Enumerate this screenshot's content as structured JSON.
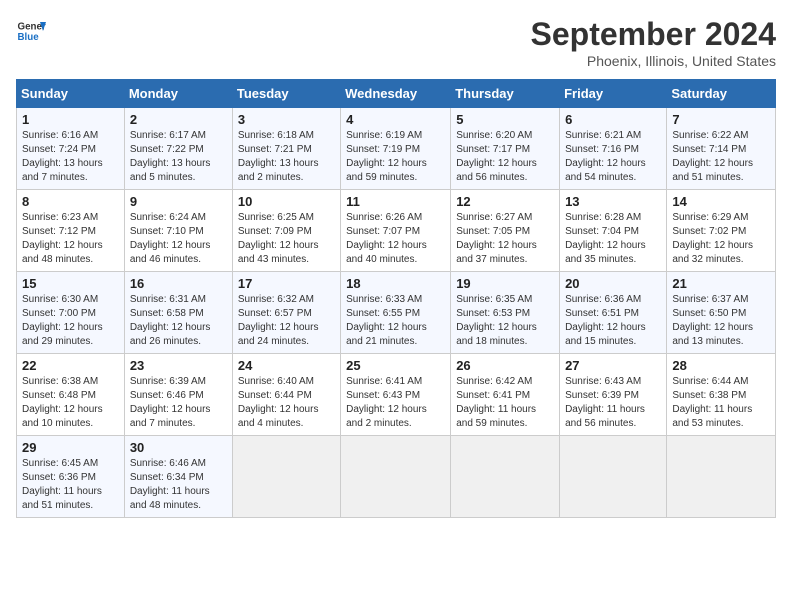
{
  "header": {
    "logo_line1": "General",
    "logo_line2": "Blue",
    "month_title": "September 2024",
    "location": "Phoenix, Illinois, United States"
  },
  "weekdays": [
    "Sunday",
    "Monday",
    "Tuesday",
    "Wednesday",
    "Thursday",
    "Friday",
    "Saturday"
  ],
  "weeks": [
    [
      {
        "day": "1",
        "sunrise": "6:16 AM",
        "sunset": "7:24 PM",
        "daylight": "13 hours and 7 minutes."
      },
      {
        "day": "2",
        "sunrise": "6:17 AM",
        "sunset": "7:22 PM",
        "daylight": "13 hours and 5 minutes."
      },
      {
        "day": "3",
        "sunrise": "6:18 AM",
        "sunset": "7:21 PM",
        "daylight": "13 hours and 2 minutes."
      },
      {
        "day": "4",
        "sunrise": "6:19 AM",
        "sunset": "7:19 PM",
        "daylight": "12 hours and 59 minutes."
      },
      {
        "day": "5",
        "sunrise": "6:20 AM",
        "sunset": "7:17 PM",
        "daylight": "12 hours and 56 minutes."
      },
      {
        "day": "6",
        "sunrise": "6:21 AM",
        "sunset": "7:16 PM",
        "daylight": "12 hours and 54 minutes."
      },
      {
        "day": "7",
        "sunrise": "6:22 AM",
        "sunset": "7:14 PM",
        "daylight": "12 hours and 51 minutes."
      }
    ],
    [
      {
        "day": "8",
        "sunrise": "6:23 AM",
        "sunset": "7:12 PM",
        "daylight": "12 hours and 48 minutes."
      },
      {
        "day": "9",
        "sunrise": "6:24 AM",
        "sunset": "7:10 PM",
        "daylight": "12 hours and 46 minutes."
      },
      {
        "day": "10",
        "sunrise": "6:25 AM",
        "sunset": "7:09 PM",
        "daylight": "12 hours and 43 minutes."
      },
      {
        "day": "11",
        "sunrise": "6:26 AM",
        "sunset": "7:07 PM",
        "daylight": "12 hours and 40 minutes."
      },
      {
        "day": "12",
        "sunrise": "6:27 AM",
        "sunset": "7:05 PM",
        "daylight": "12 hours and 37 minutes."
      },
      {
        "day": "13",
        "sunrise": "6:28 AM",
        "sunset": "7:04 PM",
        "daylight": "12 hours and 35 minutes."
      },
      {
        "day": "14",
        "sunrise": "6:29 AM",
        "sunset": "7:02 PM",
        "daylight": "12 hours and 32 minutes."
      }
    ],
    [
      {
        "day": "15",
        "sunrise": "6:30 AM",
        "sunset": "7:00 PM",
        "daylight": "12 hours and 29 minutes."
      },
      {
        "day": "16",
        "sunrise": "6:31 AM",
        "sunset": "6:58 PM",
        "daylight": "12 hours and 26 minutes."
      },
      {
        "day": "17",
        "sunrise": "6:32 AM",
        "sunset": "6:57 PM",
        "daylight": "12 hours and 24 minutes."
      },
      {
        "day": "18",
        "sunrise": "6:33 AM",
        "sunset": "6:55 PM",
        "daylight": "12 hours and 21 minutes."
      },
      {
        "day": "19",
        "sunrise": "6:35 AM",
        "sunset": "6:53 PM",
        "daylight": "12 hours and 18 minutes."
      },
      {
        "day": "20",
        "sunrise": "6:36 AM",
        "sunset": "6:51 PM",
        "daylight": "12 hours and 15 minutes."
      },
      {
        "day": "21",
        "sunrise": "6:37 AM",
        "sunset": "6:50 PM",
        "daylight": "12 hours and 13 minutes."
      }
    ],
    [
      {
        "day": "22",
        "sunrise": "6:38 AM",
        "sunset": "6:48 PM",
        "daylight": "12 hours and 10 minutes."
      },
      {
        "day": "23",
        "sunrise": "6:39 AM",
        "sunset": "6:46 PM",
        "daylight": "12 hours and 7 minutes."
      },
      {
        "day": "24",
        "sunrise": "6:40 AM",
        "sunset": "6:44 PM",
        "daylight": "12 hours and 4 minutes."
      },
      {
        "day": "25",
        "sunrise": "6:41 AM",
        "sunset": "6:43 PM",
        "daylight": "12 hours and 2 minutes."
      },
      {
        "day": "26",
        "sunrise": "6:42 AM",
        "sunset": "6:41 PM",
        "daylight": "11 hours and 59 minutes."
      },
      {
        "day": "27",
        "sunrise": "6:43 AM",
        "sunset": "6:39 PM",
        "daylight": "11 hours and 56 minutes."
      },
      {
        "day": "28",
        "sunrise": "6:44 AM",
        "sunset": "6:38 PM",
        "daylight": "11 hours and 53 minutes."
      }
    ],
    [
      {
        "day": "29",
        "sunrise": "6:45 AM",
        "sunset": "6:36 PM",
        "daylight": "11 hours and 51 minutes."
      },
      {
        "day": "30",
        "sunrise": "6:46 AM",
        "sunset": "6:34 PM",
        "daylight": "11 hours and 48 minutes."
      },
      {
        "day": "",
        "sunrise": "",
        "sunset": "",
        "daylight": ""
      },
      {
        "day": "",
        "sunrise": "",
        "sunset": "",
        "daylight": ""
      },
      {
        "day": "",
        "sunrise": "",
        "sunset": "",
        "daylight": ""
      },
      {
        "day": "",
        "sunrise": "",
        "sunset": "",
        "daylight": ""
      },
      {
        "day": "",
        "sunrise": "",
        "sunset": "",
        "daylight": ""
      }
    ]
  ]
}
